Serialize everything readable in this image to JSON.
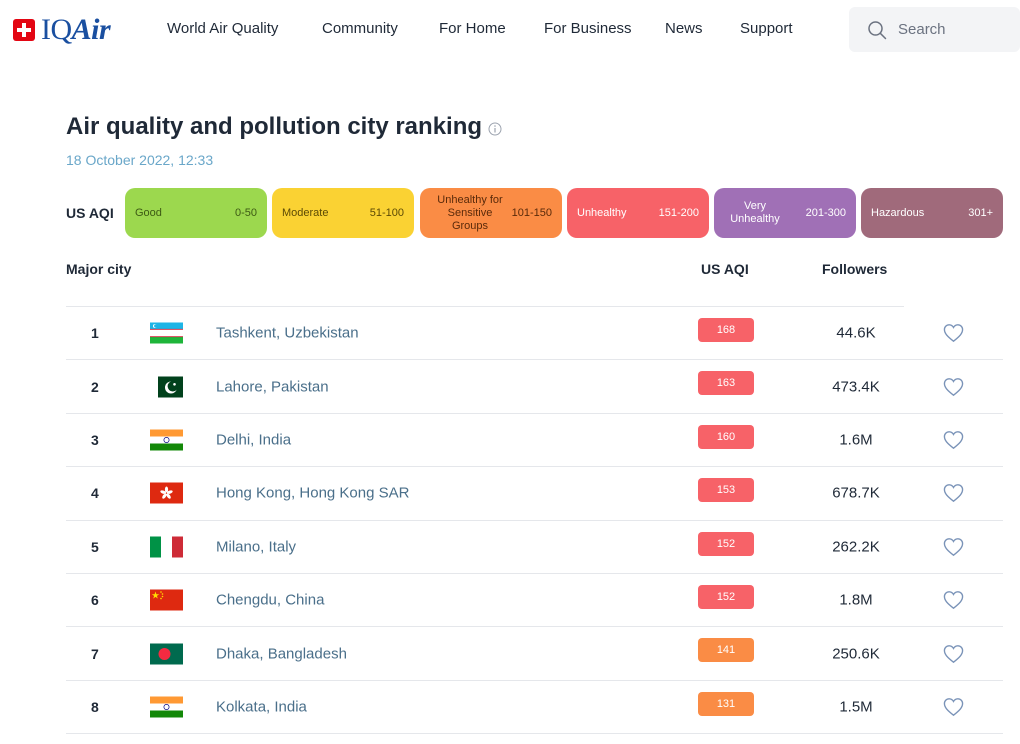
{
  "logo": {
    "text_prefix": "IQ",
    "text_suffix": "Air"
  },
  "nav": [
    "World Air Quality",
    "Community",
    "For Home",
    "For Business",
    "News",
    "Support"
  ],
  "search": {
    "placeholder": "Search"
  },
  "page": {
    "title": "Air quality and pollution city ranking",
    "date": "18 October 2022, 12:33"
  },
  "aqi_scale": {
    "label": "US AQI",
    "levels": [
      {
        "name": "Good",
        "range": "0-50",
        "color": "#9cd84e",
        "text_color": "#3d5a14"
      },
      {
        "name": "Moderate",
        "range": "51-100",
        "color": "#fad233",
        "text_color": "#5c4a05"
      },
      {
        "name": "Unhealthy for Sensitive Groups",
        "range": "101-150",
        "color": "#fa8c45",
        "text_color": "#5a2a0a"
      },
      {
        "name": "Unhealthy",
        "range": "151-200",
        "color": "#f76268",
        "text_color": "#ffffff"
      },
      {
        "name": "Very Unhealthy",
        "range": "201-300",
        "color": "#a070b6",
        "text_color": "#ffffff"
      },
      {
        "name": "Hazardous",
        "range": "301+",
        "color": "#a06a7b",
        "text_color": "#ffffff"
      }
    ]
  },
  "table": {
    "headers": {
      "city": "Major city",
      "aqi": "US AQI",
      "followers": "Followers"
    },
    "rows": [
      {
        "rank": "1",
        "flag": "uz-flag",
        "city": "Tashkent, Uzbekistan",
        "aqi": "168",
        "aqi_color": "#f76268",
        "followers": "44.6K"
      },
      {
        "rank": "2",
        "flag": "pk-flag",
        "city": "Lahore, Pakistan",
        "aqi": "163",
        "aqi_color": "#f76268",
        "followers": "473.4K"
      },
      {
        "rank": "3",
        "flag": "in-flag",
        "city": "Delhi, India",
        "aqi": "160",
        "aqi_color": "#f76268",
        "followers": "1.6M"
      },
      {
        "rank": "4",
        "flag": "hk-flag",
        "city": "Hong Kong, Hong Kong SAR",
        "aqi": "153",
        "aqi_color": "#f76268",
        "followers": "678.7K"
      },
      {
        "rank": "5",
        "flag": "it-flag",
        "city": "Milano, Italy",
        "aqi": "152",
        "aqi_color": "#f76268",
        "followers": "262.2K"
      },
      {
        "rank": "6",
        "flag": "cn-flag",
        "city": "Chengdu, China",
        "aqi": "152",
        "aqi_color": "#f76268",
        "followers": "1.8M"
      },
      {
        "rank": "7",
        "flag": "bd-flag",
        "city": "Dhaka, Bangladesh",
        "aqi": "141",
        "aqi_color": "#fa8c45",
        "followers": "250.6K"
      },
      {
        "rank": "8",
        "flag": "in-flag",
        "city": "Kolkata, India",
        "aqi": "131",
        "aqi_color": "#fa8c45",
        "followers": "1.5M"
      }
    ]
  }
}
